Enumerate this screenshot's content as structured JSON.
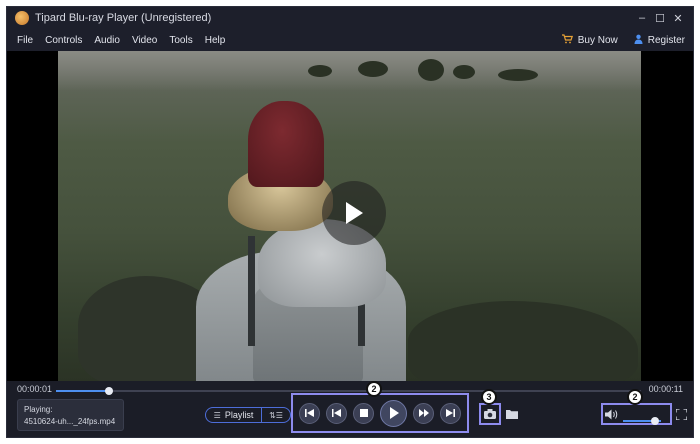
{
  "window": {
    "title": "Tipard Blu-ray Player (Unregistered)",
    "controls": {
      "minimize": "‒",
      "maximize": "☐",
      "close": "✕"
    }
  },
  "menu": {
    "items": [
      "File",
      "Controls",
      "Audio",
      "Video",
      "Tools",
      "Help"
    ],
    "buy_now": "Buy Now",
    "register": "Register"
  },
  "playback": {
    "current_time": "00:00:01",
    "total_time": "00:00:11",
    "progress": 0.09,
    "volume": 0.85
  },
  "now_playing": {
    "label": "Playing:",
    "file": "4510624-uh..._24fps.mp4"
  },
  "playlist": {
    "label": "Playlist"
  },
  "annotations": {
    "transport_badge": "2",
    "snapshot_badge": "3",
    "volume_badge": "2",
    "highlight_color": "#8d8bee"
  },
  "colors": {
    "accent": "#4d8ff0",
    "background": "#1b1d27"
  },
  "icons": {
    "transport": [
      "previous-icon",
      "rewind-icon",
      "stop-icon",
      "play-icon",
      "fast-forward-icon",
      "next-icon"
    ]
  }
}
